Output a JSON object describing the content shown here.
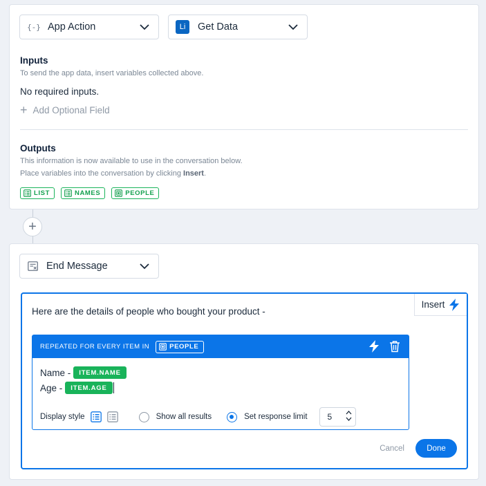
{
  "step1": {
    "action_dropdown": {
      "icon": "{-}",
      "label": "App Action"
    },
    "method_dropdown": {
      "icon": "Li",
      "label": "Get Data"
    },
    "inputs": {
      "title": "Inputs",
      "subtitle": "To send the app data, insert variables collected above.",
      "none_text": "No required inputs.",
      "add_field_label": "Add Optional Field"
    },
    "outputs": {
      "title": "Outputs",
      "desc1": "This information is now available to use in the conversation below.",
      "desc2_prefix": "Place variables into the conversation by clicking ",
      "desc2_bold": "Insert",
      "desc2_suffix": ".",
      "tags": [
        "LIST",
        "NAMES",
        "PEOPLE"
      ]
    }
  },
  "step2": {
    "dropdown": {
      "label": "End Message"
    },
    "editor": {
      "insert_label": "Insert",
      "message": "Here are the details of people who bought your product -",
      "repeat": {
        "header": "REPEATED FOR EVERY ITEM IN",
        "tag": "PEOPLE",
        "rows": [
          {
            "label": "Name -",
            "var": "ITEM.NAME"
          },
          {
            "label": "Age -",
            "var": "ITEM.AGE"
          }
        ],
        "display_style_label": "Display style",
        "show_all_label": "Show all results",
        "set_limit_label": "Set response limit",
        "limit_value": "5"
      },
      "cancel_label": "Cancel",
      "done_label": "Done"
    }
  },
  "colors": {
    "accent": "#0b75e8",
    "green": "#19b35a",
    "linkedin": "#0a66c2"
  }
}
